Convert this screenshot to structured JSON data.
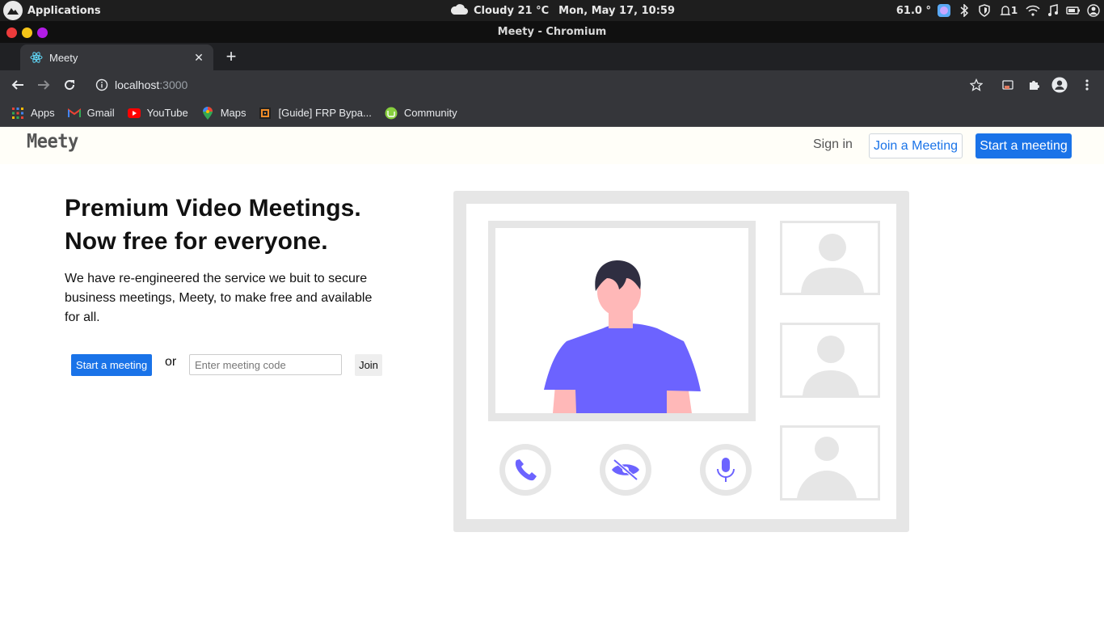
{
  "os": {
    "applications_label": "Applications",
    "weather": "Cloudy 21 °C",
    "datetime": "Mon, May 17, 10:59",
    "temperature": "61.0 °",
    "notif_count": "1"
  },
  "window": {
    "title": "Meety - Chromium"
  },
  "browser": {
    "tab_title": "Meety",
    "url_host": "localhost",
    "url_port": ":3000",
    "bookmarks": [
      {
        "label": "Apps",
        "icon": "apps-grid-icon"
      },
      {
        "label": "Gmail",
        "icon": "gmail-icon"
      },
      {
        "label": "YouTube",
        "icon": "youtube-icon"
      },
      {
        "label": "Maps",
        "icon": "maps-pin-icon"
      },
      {
        "label": "[Guide] FRP Bypa...",
        "icon": "guide-favicon-icon"
      },
      {
        "label": "Community",
        "icon": "community-favicon-icon"
      }
    ]
  },
  "navbar": {
    "brand": "Meety",
    "sign_in": "Sign in",
    "join": "Join a Meeting",
    "start": "Start a meeting"
  },
  "hero": {
    "title_line1": "Premium Video Meetings.",
    "title_line2": "Now free for everyone.",
    "description": "We have re-engineered the service we buit to secure business meetings, Meety, to make free and available for all.",
    "start_button": "Start a meeting",
    "or": "or",
    "code_placeholder": "Enter meeting code",
    "join_button": "Join"
  },
  "colors": {
    "primary": "#1a73e8",
    "illustration_accent": "#6c63ff",
    "illustration_frame": "#e6e6e6"
  }
}
